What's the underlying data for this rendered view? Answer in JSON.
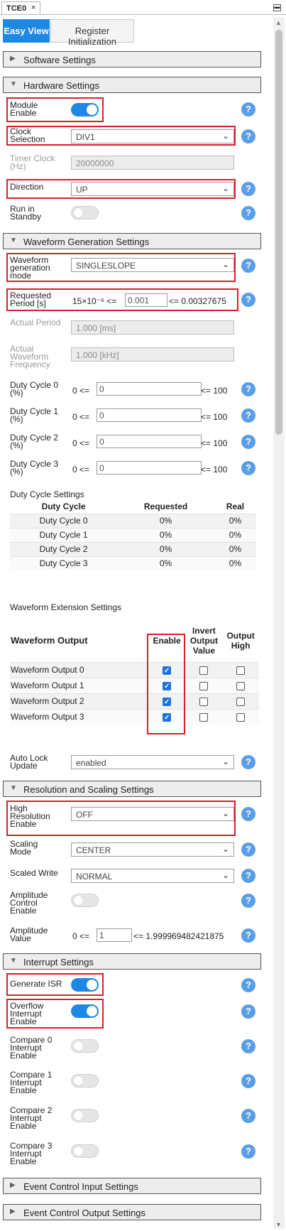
{
  "panel": {
    "title": "TCE0",
    "close": "×"
  },
  "view_tabs": {
    "easy": "Easy View",
    "register": "Register Initialization"
  },
  "sections": {
    "software": "Software Settings",
    "hardware": "Hardware Settings",
    "waveform": "Waveform Generation Settings",
    "resolution": "Resolution and Scaling Settings",
    "interrupt": "Interrupt Settings",
    "event_in": "Event Control Input Settings",
    "event_out": "Event Control Output Settings"
  },
  "hardware": {
    "module_enable": {
      "label": "Module Enable",
      "on": true
    },
    "clock_selection": {
      "label": "Clock Selection",
      "value": "DIV1"
    },
    "timer_clock": {
      "label": "Timer Clock (Hz)",
      "value": "20000000"
    },
    "direction": {
      "label": "Direction",
      "value": "UP"
    },
    "run_in_standby": {
      "label": "Run in Standby",
      "on": false
    }
  },
  "waveform": {
    "mode": {
      "label": "Waveform generation mode",
      "value": "SINGLESLOPE"
    },
    "requested_period": {
      "label": "Requested Period [s]",
      "min": "15×10⁻⁶ <=",
      "value": "0.001",
      "max": "<= 0.00327675"
    },
    "actual_period": {
      "label": "Actual Period",
      "value": "1.000 [ms]"
    },
    "actual_frequency": {
      "label": "Actual Waveform Frequency",
      "value": "1.000 [kHz]"
    },
    "duty_cycles": [
      {
        "label": "Duty Cycle 0 (%)",
        "min": "0 <=",
        "value": "0",
        "max": "<= 100"
      },
      {
        "label": "Duty Cycle 1 (%)",
        "min": "0 <=",
        "value": "0",
        "max": "<= 100"
      },
      {
        "label": "Duty Cycle 2 (%)",
        "min": "0 <=",
        "value": "0",
        "max": "<= 100"
      },
      {
        "label": "Duty Cycle 3 (%)",
        "min": "0 <=",
        "value": "0",
        "max": "<= 100"
      }
    ],
    "duty_settings_title": "Duty Cycle Settings",
    "duty_table": {
      "headers": [
        "Duty Cycle",
        "Requested",
        "Real"
      ],
      "rows": [
        [
          "Duty Cycle 0",
          "0%",
          "0%"
        ],
        [
          "Duty Cycle 1",
          "0%",
          "0%"
        ],
        [
          "Duty Cycle 2",
          "0%",
          "0%"
        ],
        [
          "Duty Cycle 3",
          "0%",
          "0%"
        ]
      ]
    },
    "extension_title": "Waveform Extension Settings",
    "output_table": {
      "headers": [
        "Waveform Output",
        "Enable",
        "Invert Output Value",
        "Output High"
      ],
      "rows": [
        {
          "name": "Waveform Output 0",
          "enable": true,
          "invert": false,
          "high": false
        },
        {
          "name": "Waveform Output 1",
          "enable": true,
          "invert": false,
          "high": false
        },
        {
          "name": "Waveform Output 2",
          "enable": true,
          "invert": false,
          "high": false
        },
        {
          "name": "Waveform Output 3",
          "enable": true,
          "invert": false,
          "high": false
        }
      ]
    },
    "auto_lock": {
      "label": "Auto Lock Update",
      "value": "enabled"
    }
  },
  "resolution": {
    "high_resolution": {
      "label": "High Resolution Enable",
      "value": "OFF"
    },
    "scaling_mode": {
      "label": "Scaling Mode",
      "value": "CENTER"
    },
    "scaled_write": {
      "label": "Scaled Write",
      "value": "NORMAL"
    },
    "amplitude_control": {
      "label": "Amplitude Control Enable",
      "on": false
    },
    "amplitude_value": {
      "label": "Amplitude Value",
      "min": "0 <=",
      "value": "1",
      "max": "<= 1.999969482421875"
    }
  },
  "interrupt": {
    "generate_isr": {
      "label": "Generate ISR",
      "on": true
    },
    "overflow": {
      "label": "Overflow Interrupt Enable",
      "on": true
    },
    "compare0": {
      "label": "Compare 0 Interrupt Enable",
      "on": false
    },
    "compare1": {
      "label": "Compare 1 Interrupt Enable",
      "on": false
    },
    "compare2": {
      "label": "Compare 2 Interrupt Enable",
      "on": false
    },
    "compare3": {
      "label": "Compare 3 Interrupt Enable",
      "on": false
    }
  },
  "help_glyph": "?",
  "colors": {
    "accent": "#1e88e5",
    "highlight": "#d81f2a",
    "help": "#5a9ee6"
  }
}
